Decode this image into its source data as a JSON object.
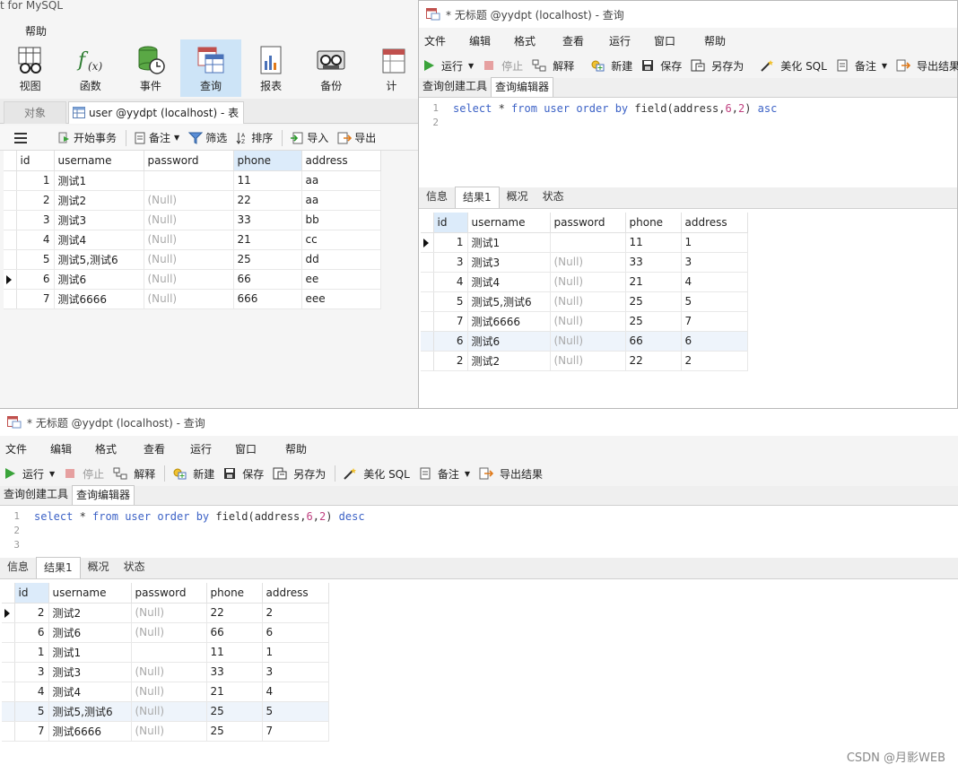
{
  "main": {
    "title": "t for MySQL",
    "menu_help": "帮助",
    "ribbon": [
      {
        "label": "视图",
        "icon": "view-icon"
      },
      {
        "label": "函数",
        "icon": "function-icon"
      },
      {
        "label": "事件",
        "icon": "event-icon"
      },
      {
        "label": "查询",
        "icon": "query-icon",
        "active": true
      },
      {
        "label": "报表",
        "icon": "report-icon"
      },
      {
        "label": "备份",
        "icon": "backup-icon"
      },
      {
        "label": "计",
        "icon": "schedule-icon"
      }
    ],
    "tab_objects": "对象",
    "tab_table": "user @yydpt (localhost) - 表",
    "toolbar": {
      "begin_tx": "开始事务",
      "memo": "备注",
      "filter": "筛选",
      "sort": "排序",
      "import": "导入",
      "export": "导出"
    },
    "columns": [
      "id",
      "username",
      "password",
      "phone",
      "address"
    ],
    "rows": [
      [
        "1",
        "测试1",
        "",
        "11",
        "aa"
      ],
      [
        "2",
        "测试2",
        "(Null)",
        "22",
        "aa"
      ],
      [
        "3",
        "测试3",
        "(Null)",
        "33",
        "bb"
      ],
      [
        "4",
        "测试4",
        "(Null)",
        "21",
        "cc"
      ],
      [
        "5",
        "测试5,测试6",
        "(Null)",
        "25",
        "dd"
      ],
      [
        "6",
        "测试6",
        "(Null)",
        "66",
        "ee"
      ],
      [
        "7",
        "测试6666",
        "(Null)",
        "666",
        "eee"
      ]
    ],
    "current_row": 5
  },
  "query_common": {
    "title": "* 无标题 @yydpt (localhost) - 查询",
    "menu": [
      "文件",
      "编辑",
      "格式",
      "查看",
      "运行",
      "窗口",
      "帮助"
    ],
    "toolbar": {
      "run": "运行",
      "stop": "停止",
      "explain": "解释",
      "new": "新建",
      "save": "保存",
      "save_as": "另存为",
      "beautify": "美化 SQL",
      "memo": "备注",
      "export": "导出结果"
    },
    "subtabs": [
      "查询创建工具",
      "查询编辑器"
    ],
    "result_tabs": [
      "信息",
      "结果1",
      "概况",
      "状态"
    ],
    "columns": [
      "id",
      "username",
      "password",
      "phone",
      "address"
    ]
  },
  "query_asc": {
    "line_numbers": [
      "1",
      "2"
    ],
    "sql": {
      "kw1": "select",
      "star": " * ",
      "kw2": "from",
      "kw3": "user",
      "kw4": "order",
      "kw5": "by",
      "fn": " field(address,",
      "n1": "6",
      "comma": ",",
      "n2": "2",
      "close": ") ",
      "dir": "asc"
    },
    "rows": [
      [
        "1",
        "测试1",
        "",
        "11",
        "1"
      ],
      [
        "3",
        "测试3",
        "(Null)",
        "33",
        "3"
      ],
      [
        "4",
        "测试4",
        "(Null)",
        "21",
        "4"
      ],
      [
        "5",
        "测试5,测试6",
        "(Null)",
        "25",
        "5"
      ],
      [
        "7",
        "测试6666",
        "(Null)",
        "25",
        "7"
      ],
      [
        "6",
        "测试6",
        "(Null)",
        "66",
        "6"
      ],
      [
        "2",
        "测试2",
        "(Null)",
        "22",
        "2"
      ]
    ],
    "current_row": 0,
    "highlight_row": 5
  },
  "query_desc": {
    "line_numbers": [
      "1",
      "2",
      "3"
    ],
    "sql": {
      "kw1": "select",
      "star": " * ",
      "kw2": "from",
      "kw3": "user",
      "kw4": "order",
      "kw5": "by",
      "fn": " field(address,",
      "n1": "6",
      "comma": ",",
      "n2": "2",
      "close": ") ",
      "dir": "desc"
    },
    "rows": [
      [
        "2",
        "测试2",
        "(Null)",
        "22",
        "2"
      ],
      [
        "6",
        "测试6",
        "(Null)",
        "66",
        "6"
      ],
      [
        "1",
        "测试1",
        "",
        "11",
        "1"
      ],
      [
        "3",
        "测试3",
        "(Null)",
        "33",
        "3"
      ],
      [
        "4",
        "测试4",
        "(Null)",
        "21",
        "4"
      ],
      [
        "5",
        "测试5,测试6",
        "(Null)",
        "25",
        "5"
      ],
      [
        "7",
        "测试6666",
        "(Null)",
        "25",
        "7"
      ]
    ],
    "current_row": 0,
    "highlight_row": 5
  },
  "watermark": "CSDN @月影WEB"
}
